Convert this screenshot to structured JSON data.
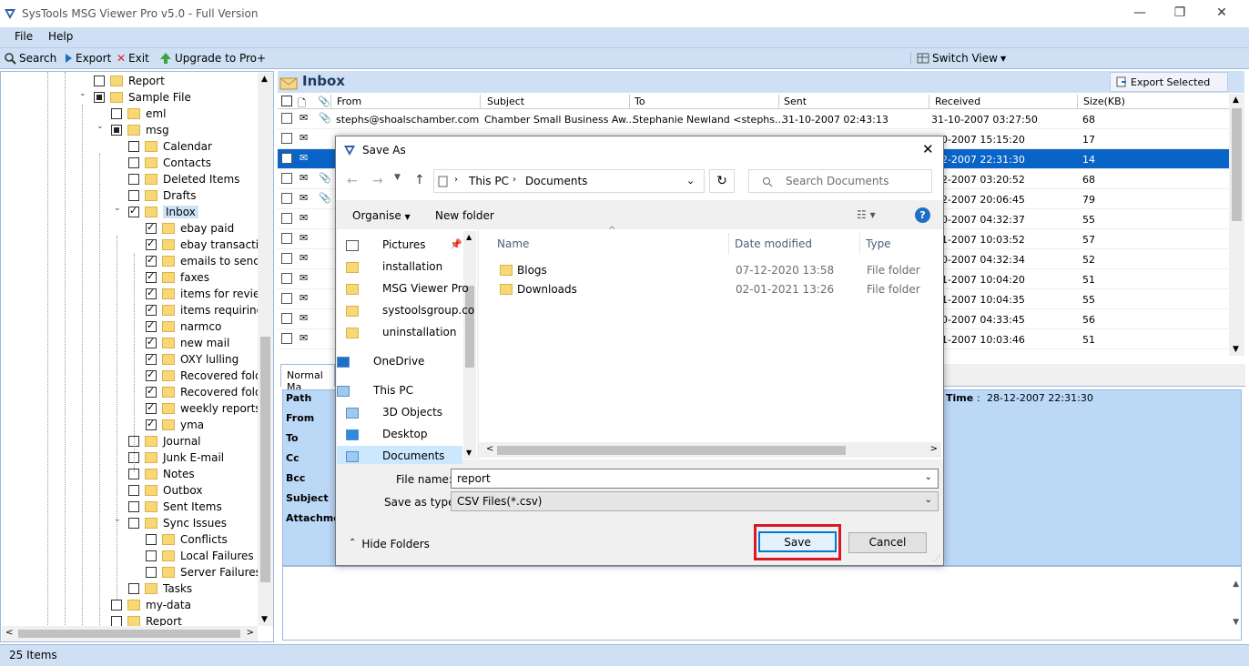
{
  "app": {
    "title": "SysTools MSG Viewer Pro v5.0 - Full Version"
  },
  "menu": {
    "file": "File",
    "help": "Help"
  },
  "toolbar": {
    "search": "Search",
    "export": "Export",
    "exit": "Exit",
    "upgrade": "Upgrade to Pro+",
    "switch_view": "Switch View"
  },
  "tree": [
    {
      "label": "Report",
      "state": "unchecked",
      "level": 4
    },
    {
      "label": "Sample File",
      "state": "partial",
      "level": 4
    },
    {
      "label": "eml",
      "state": "unchecked",
      "level": 5
    },
    {
      "label": "msg",
      "state": "partial",
      "level": 5
    },
    {
      "label": "Calendar",
      "state": "unchecked",
      "level": 6
    },
    {
      "label": "Contacts",
      "state": "unchecked",
      "level": 6
    },
    {
      "label": "Deleted Items",
      "state": "unchecked",
      "level": 6
    },
    {
      "label": "Drafts",
      "state": "unchecked",
      "level": 6
    },
    {
      "label": "Inbox",
      "state": "checked",
      "level": 6
    },
    {
      "label": "ebay paid",
      "state": "checked",
      "level": 7
    },
    {
      "label": "ebay transaction",
      "state": "checked",
      "level": 7
    },
    {
      "label": "emails to send",
      "state": "checked",
      "level": 7
    },
    {
      "label": "faxes",
      "state": "checked",
      "level": 7
    },
    {
      "label": "items for review",
      "state": "checked",
      "level": 7
    },
    {
      "label": "items requiring r",
      "state": "checked",
      "level": 7
    },
    {
      "label": "narmco",
      "state": "checked",
      "level": 7
    },
    {
      "label": "new mail",
      "state": "checked",
      "level": 7
    },
    {
      "label": "OXY lulling",
      "state": "checked",
      "level": 7
    },
    {
      "label": "Recovered folde",
      "state": "checked",
      "level": 7
    },
    {
      "label": "Recovered folde",
      "state": "checked",
      "level": 7
    },
    {
      "label": "weekly reports",
      "state": "checked",
      "level": 7
    },
    {
      "label": "yma",
      "state": "checked",
      "level": 7
    },
    {
      "label": "Journal",
      "state": "unchecked",
      "level": 6
    },
    {
      "label": "Junk E-mail",
      "state": "unchecked",
      "level": 6
    },
    {
      "label": "Notes",
      "state": "unchecked",
      "level": 6
    },
    {
      "label": "Outbox",
      "state": "unchecked",
      "level": 6
    },
    {
      "label": "Sent Items",
      "state": "unchecked",
      "level": 6
    },
    {
      "label": "Sync Issues",
      "state": "unchecked",
      "level": 6
    },
    {
      "label": "Conflicts",
      "state": "unchecked",
      "level": 7
    },
    {
      "label": "Local Failures",
      "state": "unchecked",
      "level": 7
    },
    {
      "label": "Server Failures",
      "state": "unchecked",
      "level": 7
    },
    {
      "label": "Tasks",
      "state": "unchecked",
      "level": 6
    },
    {
      "label": "my-data",
      "state": "unchecked",
      "level": 5
    },
    {
      "label": "Report",
      "state": "unchecked",
      "level": 5
    }
  ],
  "inbox": {
    "title": "Inbox",
    "export_selected": "Export Selected"
  },
  "columns": {
    "from": "From",
    "subject": "Subject",
    "to": "To",
    "sent": "Sent",
    "received": "Received",
    "size": "Size(KB)"
  },
  "mails": [
    {
      "from": "stephs@shoalschamber.com",
      "subject": "Chamber Small Business Aw...",
      "to": "Stephanie Newland <stephs...",
      "sent": "31-10-2007 02:43:13",
      "received": "31-10-2007 03:27:50",
      "size": "68"
    },
    {
      "from": "",
      "subject": "",
      "to": "",
      "sent": "",
      "received": "-10-2007 15:15:20",
      "size": "17"
    },
    {
      "from": "",
      "subject": "",
      "to": "",
      "sent": "",
      "received": "-12-2007 22:31:30",
      "size": "14"
    },
    {
      "from": "",
      "subject": "",
      "to": "",
      "sent": "",
      "received": "-12-2007 03:20:52",
      "size": "68"
    },
    {
      "from": "",
      "subject": "",
      "to": "",
      "sent": "",
      "received": "-12-2007 20:06:45",
      "size": "79"
    },
    {
      "from": "",
      "subject": "",
      "to": "",
      "sent": "",
      "received": "-10-2007 04:32:37",
      "size": "55"
    },
    {
      "from": "",
      "subject": "",
      "to": "",
      "sent": "",
      "received": "-11-2007 10:03:52",
      "size": "57"
    },
    {
      "from": "",
      "subject": "",
      "to": "",
      "sent": "",
      "received": "-10-2007 04:32:34",
      "size": "52"
    },
    {
      "from": "",
      "subject": "",
      "to": "",
      "sent": "",
      "received": "-11-2007 10:04:20",
      "size": "51"
    },
    {
      "from": "",
      "subject": "",
      "to": "",
      "sent": "",
      "received": "-11-2007 10:04:35",
      "size": "55"
    },
    {
      "from": "",
      "subject": "",
      "to": "",
      "sent": "",
      "received": "-10-2007 04:33:45",
      "size": "56"
    },
    {
      "from": "",
      "subject": "",
      "to": "",
      "sent": "",
      "received": "-11-2007 10:03:46",
      "size": "51"
    }
  ],
  "preview": {
    "tab": "Normal Ma",
    "labels": [
      "Path",
      "From",
      "To",
      "Cc",
      "Bcc",
      "Subject",
      "Attachme"
    ],
    "time_label": "Time",
    "time_value": "28-12-2007 22:31:30"
  },
  "status": {
    "items": "25 Items"
  },
  "dialog": {
    "title": "Save As",
    "breadcrumb": [
      "This PC",
      "Documents"
    ],
    "search_placeholder": "Search Documents",
    "organise": "Organise",
    "new_folder": "New folder",
    "nav": [
      "Pictures",
      "installation",
      "MSG Viewer Pro",
      "systoolsgroup.co",
      "uninstallation",
      "OneDrive",
      "This PC",
      "3D Objects",
      "Desktop",
      "Documents"
    ],
    "cols": {
      "name": "Name",
      "date": "Date modified",
      "type": "Type"
    },
    "files": [
      {
        "name": "Blogs",
        "date": "07-12-2020 13:58",
        "type": "File folder"
      },
      {
        "name": "Downloads",
        "date": "02-01-2021 13:26",
        "type": "File folder"
      }
    ],
    "filename_label": "File name:",
    "filename_value": "report",
    "savetype_label": "Save as type:",
    "savetype_value": "CSV Files(*.csv)",
    "hide_folders": "Hide Folders",
    "save": "Save",
    "cancel": "Cancel"
  }
}
